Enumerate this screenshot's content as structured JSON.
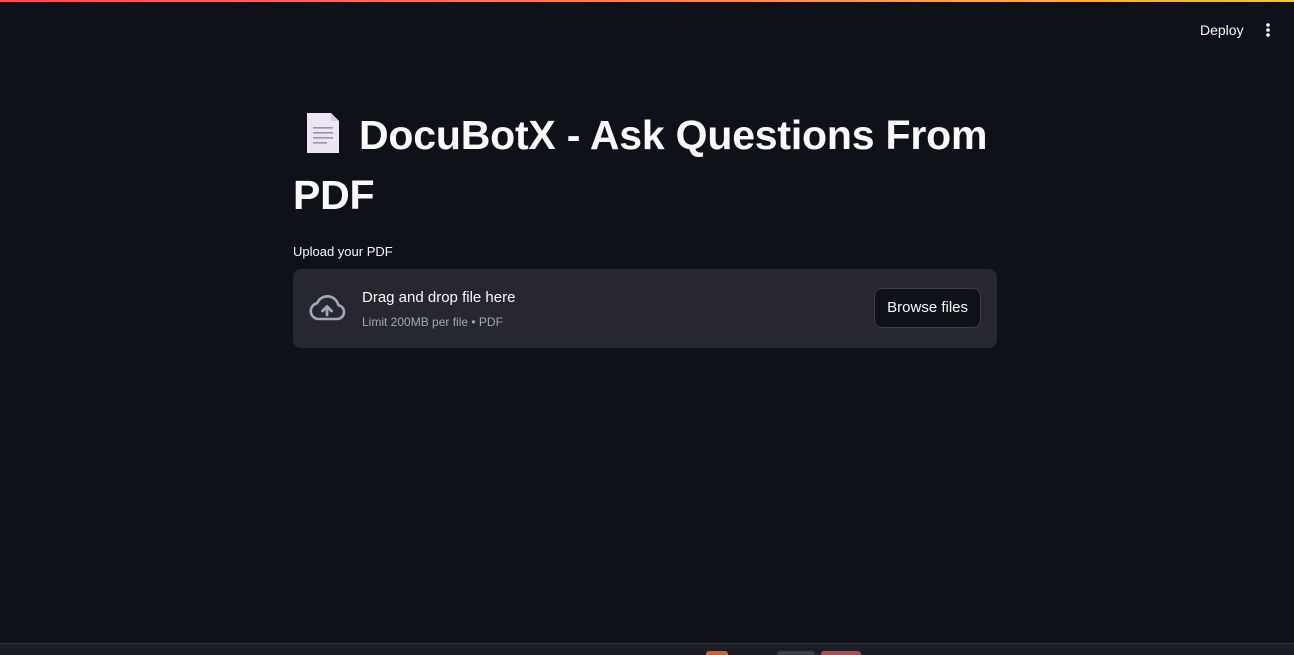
{
  "header": {
    "deploy_label": "Deploy",
    "menu_icon": "vertical-ellipsis-icon"
  },
  "main": {
    "title": "DocuBotX - Ask Questions From PDF",
    "title_emoji": "page-document-icon"
  },
  "uploader": {
    "label": "Upload your PDF",
    "dropzone_title": "Drag and drop file here",
    "dropzone_limit": "Limit 200MB per file • PDF",
    "browse_label": "Browse files",
    "icon": "cloud-upload-icon"
  },
  "colors": {
    "background": "#0e1117",
    "dropzone": "#262730",
    "text": "#fafafa",
    "muted_text": "#a3a8b8",
    "decoration_start": "#ff4b4b",
    "decoration_end": "#ffbd45"
  }
}
